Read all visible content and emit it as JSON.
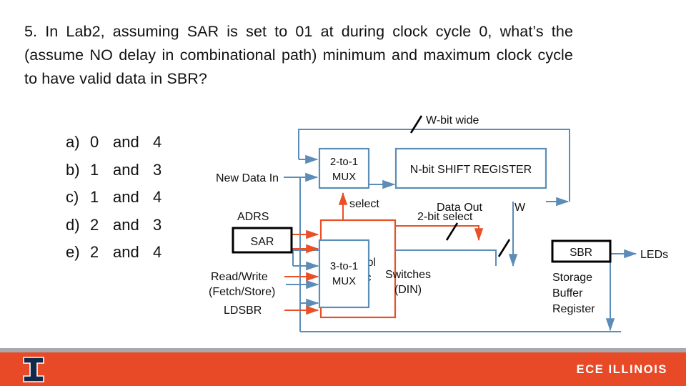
{
  "slide": {
    "question": "5. In Lab2, assuming SAR is set to 01 at during clock cycle 0, what’s the (assume NO delay in combinational path) minimum and maximum clock cycle to have valid data in SBR?",
    "answers": [
      {
        "letter": "a)",
        "first": "0",
        "conj": "and",
        "second": "4"
      },
      {
        "letter": "b)",
        "first": "1",
        "conj": "and",
        "second": "3"
      },
      {
        "letter": "c)",
        "first": "1",
        "conj": "and",
        "second": "4"
      },
      {
        "letter": "d)",
        "first": "2",
        "conj": "and",
        "second": "3"
      },
      {
        "letter": "e)",
        "first": "2",
        "conj": "and",
        "second": "4"
      }
    ]
  },
  "diagram": {
    "title": "lab2-memory-datapath-block-diagram",
    "labels": {
      "w_bit_wide": "W-bit wide",
      "new_data_in": "New Data In",
      "mux_2to1_line1": "2-to-1",
      "mux_2to1_line2": "MUX",
      "shift_register": "N-bit SHIFT REGISTER",
      "select": "select",
      "adrs": "ADRS",
      "sar": "SAR",
      "read_write_line1": "Read/Write",
      "read_write_line2": "(Fetch/Store)",
      "ldsbr": "LDSBR",
      "control_line1": "Control",
      "control_line2": "Logic",
      "two_bit_select": "2-bit select",
      "switches_line1": "Switches",
      "switches_line2": "(DIN)",
      "mux_3to1_line1": "3-to-1",
      "mux_3to1_line2": "MUX",
      "data_out": "Data Out",
      "w_width": "W",
      "sbr": "SBR",
      "storage_line1": "Storage",
      "storage_line2": "Buffer",
      "storage_line3": "Register",
      "leds": "LEDs"
    },
    "colors": {
      "blue_wire": "#5b8db8",
      "red_wire": "#e8502a",
      "black_box": "#000000"
    }
  },
  "footer": {
    "wordmark": "ECE ILLINOIS",
    "bar_color": "#e84a27",
    "strip_color": "#a7a9ac",
    "logo_color": "#13294b"
  }
}
